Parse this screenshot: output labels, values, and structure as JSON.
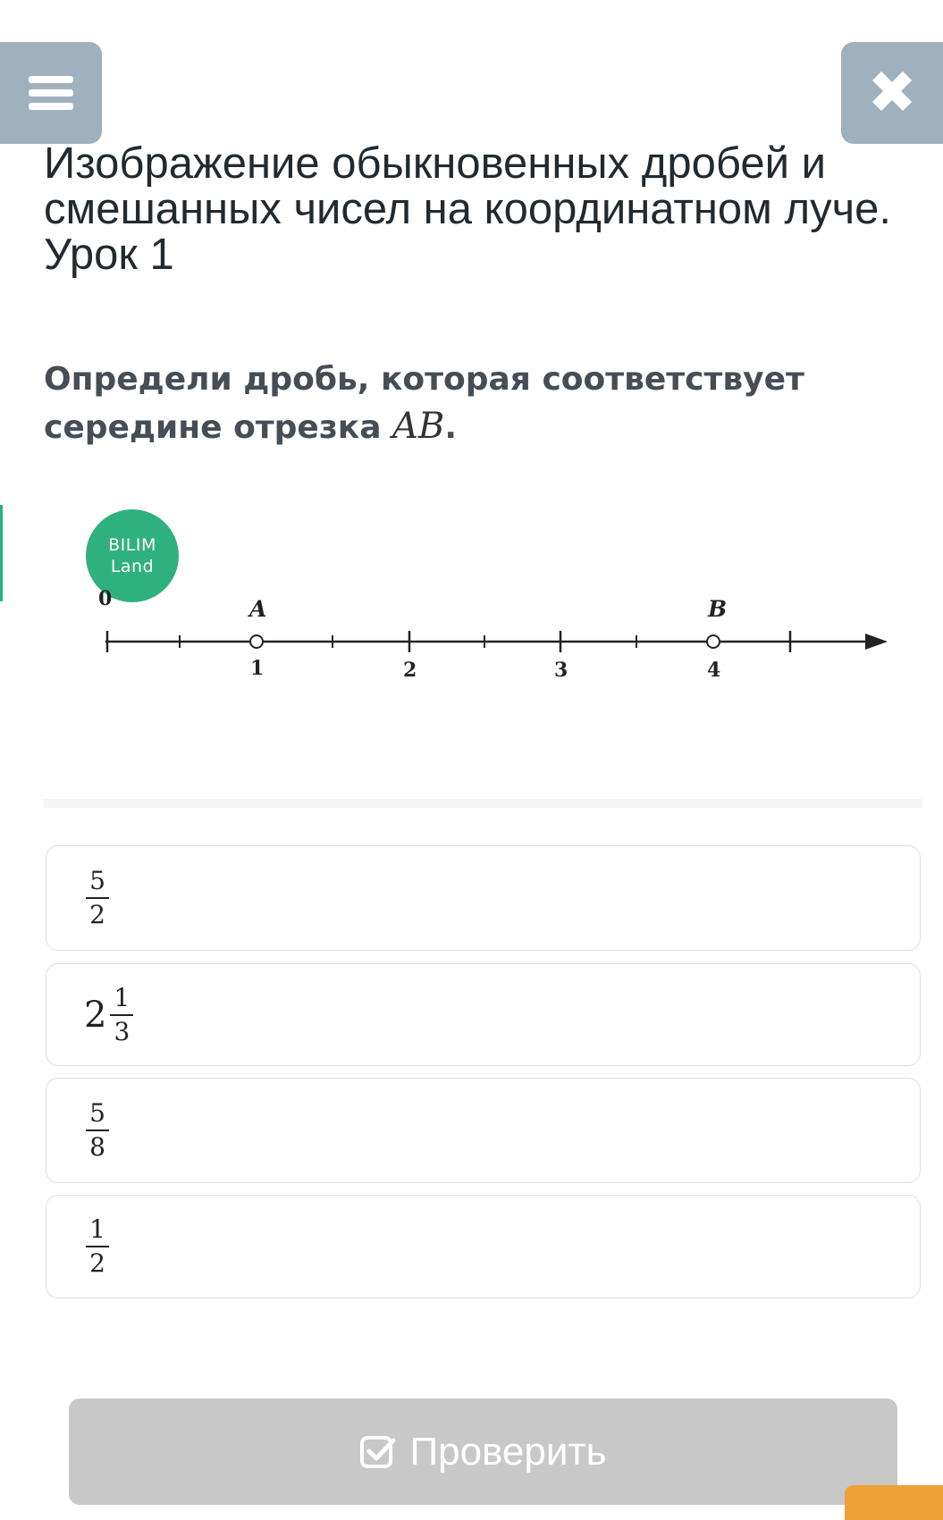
{
  "header": {
    "menu_icon": "menu-icon",
    "close_icon": "close-icon",
    "close_glyph": "✖",
    "title": "Изображение обыкновенных дробей и смешанных чисел на координатном луче. Урок 1"
  },
  "question": {
    "text": "Определи дробь, которая соответствует середине отрезка ",
    "segment": "AB",
    "end": "."
  },
  "figure": {
    "logo_line1": "BILIM",
    "logo_line2": "Land",
    "origin_label": "0",
    "point_a": "A",
    "point_b": "B",
    "tick_1": "1",
    "tick_2": "2",
    "tick_3": "3",
    "tick_4": "4"
  },
  "options": [
    {
      "whole": "",
      "num": "5",
      "den": "2"
    },
    {
      "whole": "2",
      "num": "1",
      "den": "3"
    },
    {
      "whole": "",
      "num": "5",
      "den": "8"
    },
    {
      "whole": "",
      "num": "1",
      "den": "2"
    }
  ],
  "footer": {
    "check_label": "Проверить",
    "check_icon": "check-square-icon"
  },
  "colors": {
    "corner_buttons": "#9fb1bd",
    "brand_green": "#2fb17f",
    "button_disabled": "#c8c8c8",
    "orange": "#f0a038"
  }
}
